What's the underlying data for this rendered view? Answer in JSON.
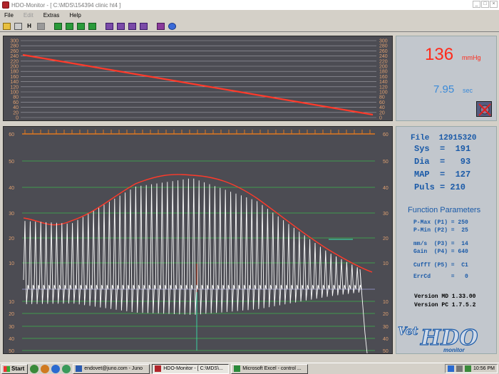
{
  "window": {
    "title": "HDO-Monitor - [ C:\\MDS\\154394 clinic ht4 ]",
    "controls": [
      "_",
      "□",
      "×"
    ]
  },
  "menu": {
    "file": "File",
    "edit": "Edit",
    "extras": "Extras",
    "help": "Help"
  },
  "toolbar": {
    "h_label": "H"
  },
  "top_chart": {
    "axis_labels": [
      "300",
      "280",
      "260",
      "240",
      "220",
      "200",
      "180",
      "160",
      "140",
      "120",
      "100",
      "80",
      "60",
      "40",
      "20",
      "0"
    ],
    "colors": {
      "background": "#4c4c53",
      "grid": "#a0a0a8",
      "axis_text": "#e0a070",
      "trace": "#ff3a2a"
    }
  },
  "main_chart": {
    "left_labels": [
      "60",
      "50",
      "40",
      "30",
      "20",
      "10",
      "",
      "10",
      "20",
      "30",
      "40",
      "50"
    ],
    "right_labels": [
      "60",
      "50",
      "40",
      "30",
      "20",
      "10",
      "",
      "10",
      "20",
      "30",
      "40",
      "50"
    ],
    "colors": {
      "background": "#4c4c53",
      "grid": "#3db54a",
      "axis_text": "#e0a070",
      "trace": "#ffffff",
      "envelope": "#ff3a2a"
    }
  },
  "readout": {
    "pressure_value": "136",
    "pressure_unit": "mmHg",
    "time_value": "7.95",
    "time_unit": "sec"
  },
  "results": {
    "file": "File  12915320",
    "sys": "Sys  =  191",
    "dia": "Dia  =   93",
    "map": "MAP  =  127",
    "puls": "Puls = 210"
  },
  "params": {
    "title": "Function Parameters",
    "pmax": "P-Max (P1) = 250",
    "pmin": "P-Min (P2) =  25",
    "mms": "mm/s  (P3) =  14",
    "gain": "Gain  (P4) = 640",
    "cufft": "CuffT (P5) =  C1",
    "errcd": "ErrCd      =   0",
    "version_md": "Version MD 1.33.00",
    "version_pc": "Version PC 1.7.5.2"
  },
  "logo": {
    "main": "HDO",
    "sub": "monitor",
    "prefix": "Vet"
  },
  "taskbar": {
    "start": "Start",
    "tasks": [
      "endovet@juno.com - Juno",
      "HDO-Monitor - [ C:\\MDS\\...",
      "Microsoft Excel - control ..."
    ],
    "clock": "10:56 PM"
  }
}
